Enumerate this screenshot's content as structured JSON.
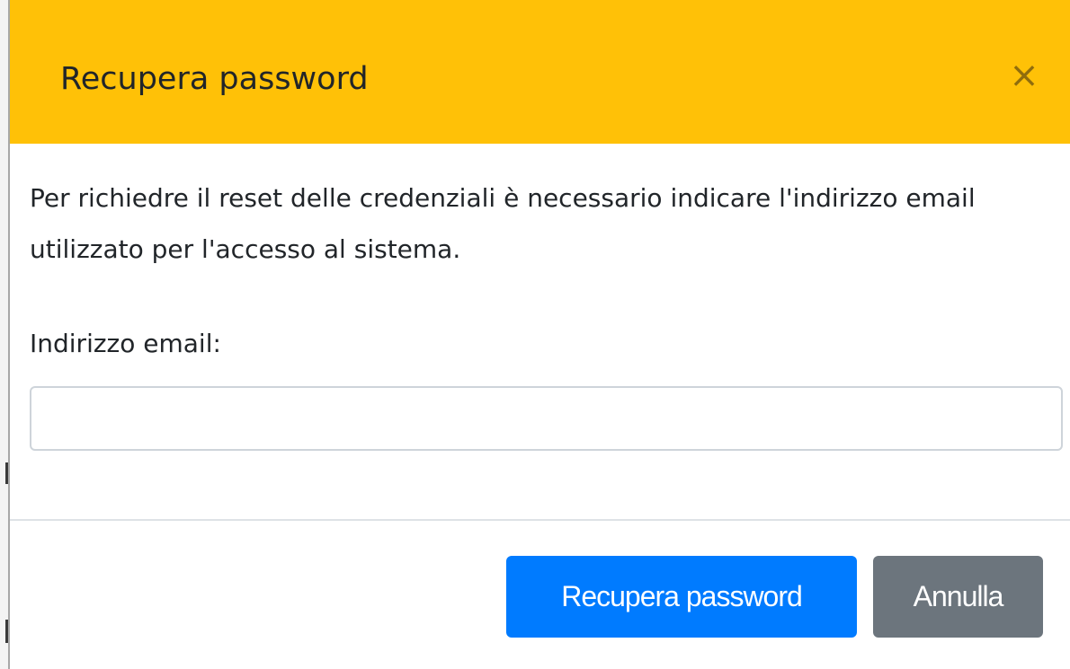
{
  "modal": {
    "title": "Recupera password",
    "close_symbol": "×",
    "description": "Per richiedre il reset delle credenziali è necessario indicare l'indirizzo email utilizzato per l'accesso al sistema.",
    "email_label": "Indirizzo email:",
    "email_value": "",
    "submit_label": "Recupera password",
    "cancel_label": "Annulla"
  },
  "colors": {
    "header_bg": "#ffc107",
    "primary_button": "#007bff",
    "secondary_button": "#6c757d",
    "text": "#212529"
  },
  "icons": {
    "close": "close-icon"
  }
}
